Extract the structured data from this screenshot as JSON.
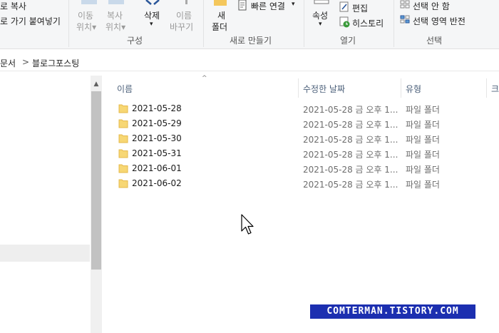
{
  "ribbon": {
    "clipboard": {
      "copy_path_label": "로 복사",
      "paste_shortcut_label": "로 가기 붙여넣기"
    },
    "organize": {
      "move_to_label_1": "이동",
      "move_to_label_2": "위치▾",
      "copy_to_label_1": "복사",
      "copy_to_label_2": "위치▾",
      "delete_label": "삭제",
      "delete_arrow": "▾",
      "rename_label_1": "이름",
      "rename_label_2": "바꾸기",
      "group_label": "구성"
    },
    "new": {
      "new_folder_label_1": "새",
      "new_folder_label_2": "폴더",
      "easy_access_label": "빠른 연결",
      "group_label": "새로 만들기"
    },
    "open": {
      "properties_label": "속성",
      "properties_arrow": "▾",
      "edit_label": "편집",
      "history_label": "히스토리",
      "group_label": "열기"
    },
    "select": {
      "select_none_label": "선택 안 함",
      "invert_selection_label": "선택 영역 반전",
      "group_label": "선택"
    }
  },
  "address": {
    "parent": "문서",
    "separator": ">",
    "current": "블로그포스팅"
  },
  "columns": {
    "name": "이름",
    "date": "수정한 날짜",
    "type": "유형",
    "size": "크"
  },
  "files": [
    {
      "name": "2021-05-28",
      "date": "2021-05-28 금 오후 1...",
      "type": "파일 폴더"
    },
    {
      "name": "2021-05-29",
      "date": "2021-05-28 금 오후 1...",
      "type": "파일 폴더"
    },
    {
      "name": "2021-05-30",
      "date": "2021-05-28 금 오후 1...",
      "type": "파일 폴더"
    },
    {
      "name": "2021-05-31",
      "date": "2021-05-28 금 오후 1...",
      "type": "파일 폴더"
    },
    {
      "name": "2021-06-01",
      "date": "2021-05-28 금 오후 1...",
      "type": "파일 폴더"
    },
    {
      "name": "2021-06-02",
      "date": "2021-05-28 금 오후 1...",
      "type": "파일 폴더"
    }
  ],
  "watermark": "COMTERMAN.TISTORY.COM",
  "colors": {
    "folder": "#f7d774",
    "folder_dark": "#e6b94a",
    "watermark_bg": "#1c2fb0",
    "accent": "#4c607a"
  }
}
